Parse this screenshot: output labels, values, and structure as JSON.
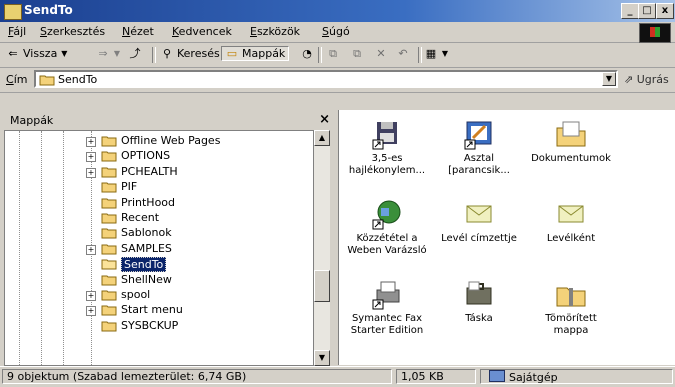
{
  "window": {
    "title": "SendTo"
  },
  "menu": [
    "Fájl",
    "Szerkesztés",
    "Nézet",
    "Kedvencek",
    "Eszközök",
    "Súgó"
  ],
  "toolbar": {
    "back_label": "Vissza",
    "search_label": "Keresés",
    "folders_label": "Mappák"
  },
  "address": {
    "label": "Cím",
    "value": "SendTo",
    "go_label": "Ugrás"
  },
  "folder_pane": {
    "title": "Mappák",
    "items": [
      {
        "label": "Offline Web Pages",
        "expander": "+"
      },
      {
        "label": "OPTIONS",
        "expander": "+"
      },
      {
        "label": "PCHEALTH",
        "expander": "+"
      },
      {
        "label": "PIF",
        "expander": ""
      },
      {
        "label": "PrintHood",
        "expander": ""
      },
      {
        "label": "Recent",
        "expander": ""
      },
      {
        "label": "Sablonok",
        "expander": ""
      },
      {
        "label": "SAMPLES",
        "expander": "+"
      },
      {
        "label": "SendTo",
        "expander": "",
        "selected": true
      },
      {
        "label": "ShellNew",
        "expander": ""
      },
      {
        "label": "spool",
        "expander": "+"
      },
      {
        "label": "Start menu",
        "expander": "+"
      },
      {
        "label": "SYSBCKUP",
        "expander": ""
      }
    ]
  },
  "files": [
    {
      "line1": "3,5-es",
      "line2": "hajlékonylem...",
      "icon": "floppy-shortcut-icon"
    },
    {
      "line1": "Asztal",
      "line2": "[parancsik...",
      "icon": "desktop-shortcut-icon"
    },
    {
      "line1": "Dokumentumok",
      "line2": "",
      "icon": "my-documents-icon"
    },
    {
      "line1": "Közzététel a",
      "line2": "Weben Varázsló",
      "icon": "web-publishing-wizard-icon"
    },
    {
      "line1": "Levél címzettje",
      "line2": "",
      "icon": "mail-recipient-icon"
    },
    {
      "line1": "Levélként",
      "line2": "",
      "icon": "mail-envelope-icon"
    },
    {
      "line1": "Symantec Fax",
      "line2": "Starter Edition",
      "icon": "fax-icon"
    },
    {
      "line1": "Táska",
      "line2": "",
      "icon": "briefcase-icon"
    },
    {
      "line1": "Tömörített",
      "line2": "mappa",
      "icon": "compressed-folder-icon"
    }
  ],
  "status": {
    "objects": "9 objektum (Szabad lemezterület: 6,74 GB)",
    "size": "1,05 KB",
    "zone": "Sajátgép"
  }
}
